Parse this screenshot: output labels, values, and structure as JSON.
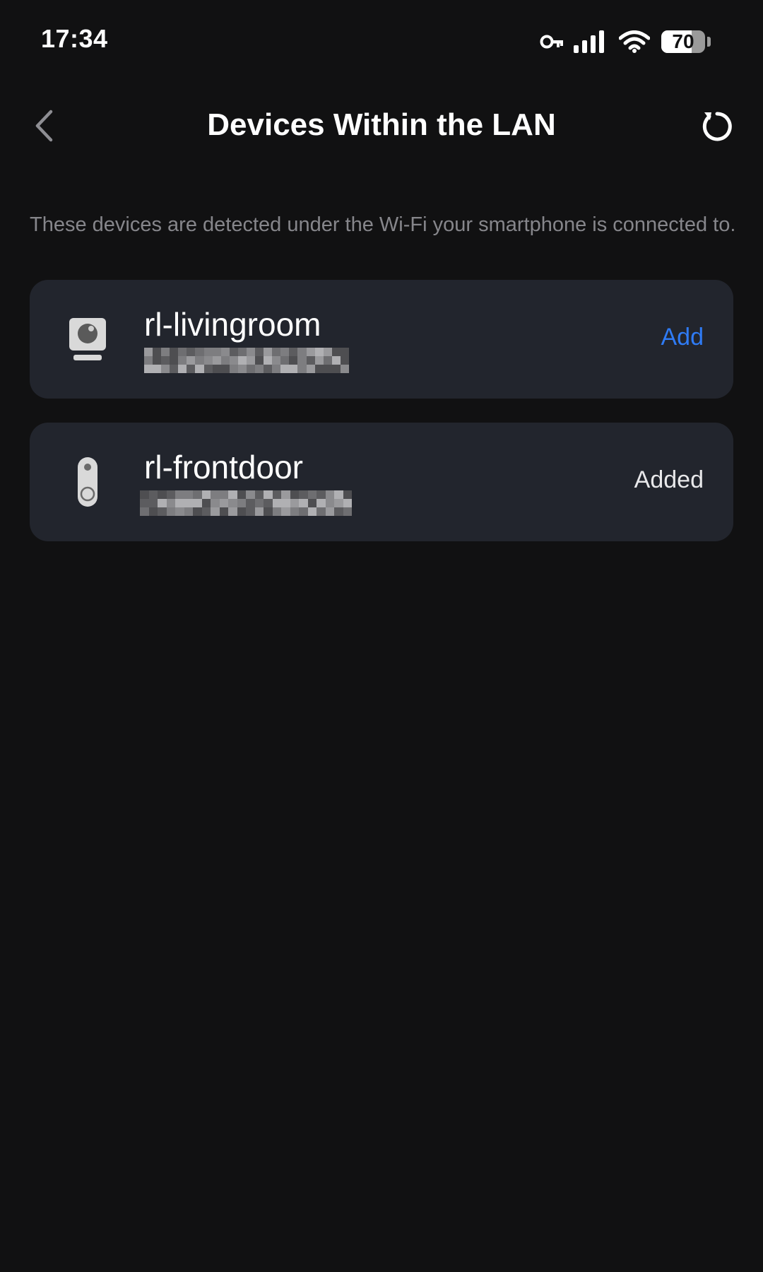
{
  "status_bar": {
    "time": "17:34",
    "battery_level": "70",
    "battery_fraction": 0.7,
    "icons": [
      "vpn-key-icon",
      "cellular-signal-icon",
      "wifi-icon",
      "battery-icon"
    ]
  },
  "header": {
    "title": "Devices Within the LAN",
    "back_icon": "chevron-left-icon",
    "refresh_icon": "refresh-icon"
  },
  "description": "These devices are detected under the Wi-Fi your smartphone is connected to.",
  "devices": [
    {
      "name": "rl-livingroom",
      "icon": "camera-icon",
      "action": "Add",
      "action_color": "#2f7bf5"
    },
    {
      "name": "rl-frontdoor",
      "icon": "doorbell-icon",
      "status": "Added"
    }
  ],
  "colors": {
    "background": "#111112",
    "card": "#22252d",
    "accent": "#2f7bf5",
    "secondary_text": "#86868b"
  }
}
